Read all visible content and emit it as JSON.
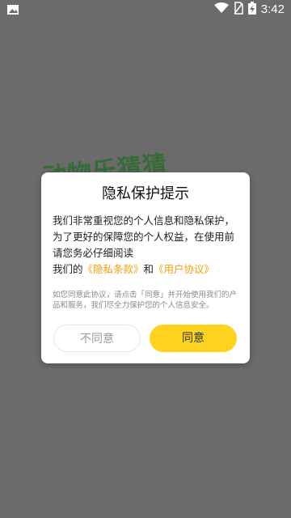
{
  "status_bar": {
    "time": "3:42",
    "icons": [
      "image-icon",
      "wifi-icon",
      "no-sim-icon",
      "battery-charging-icon"
    ]
  },
  "background": {
    "app_title": "动物乐猜猜"
  },
  "dialog": {
    "title": "隐私保护提示",
    "body_line1": "我们非常重视您的个人信息和隐私保护，为了更好的保障您的个人权益，在使用前请您务必仔细阅读",
    "body_prefix": "我们的",
    "privacy_link": "《隐私条款》",
    "and_text": "和",
    "user_agreement_link": "《用户协议》",
    "note": "如您同意此协议，请点击「同意」并开始使用我们的产品和服务，我们尽全力保护您的个人信息安全。",
    "disagree_label": "不同意",
    "agree_label": "同意"
  },
  "colors": {
    "overlay": "#6b6b6b",
    "link": "#f2a00a",
    "agree_button": "#ffd21e"
  }
}
